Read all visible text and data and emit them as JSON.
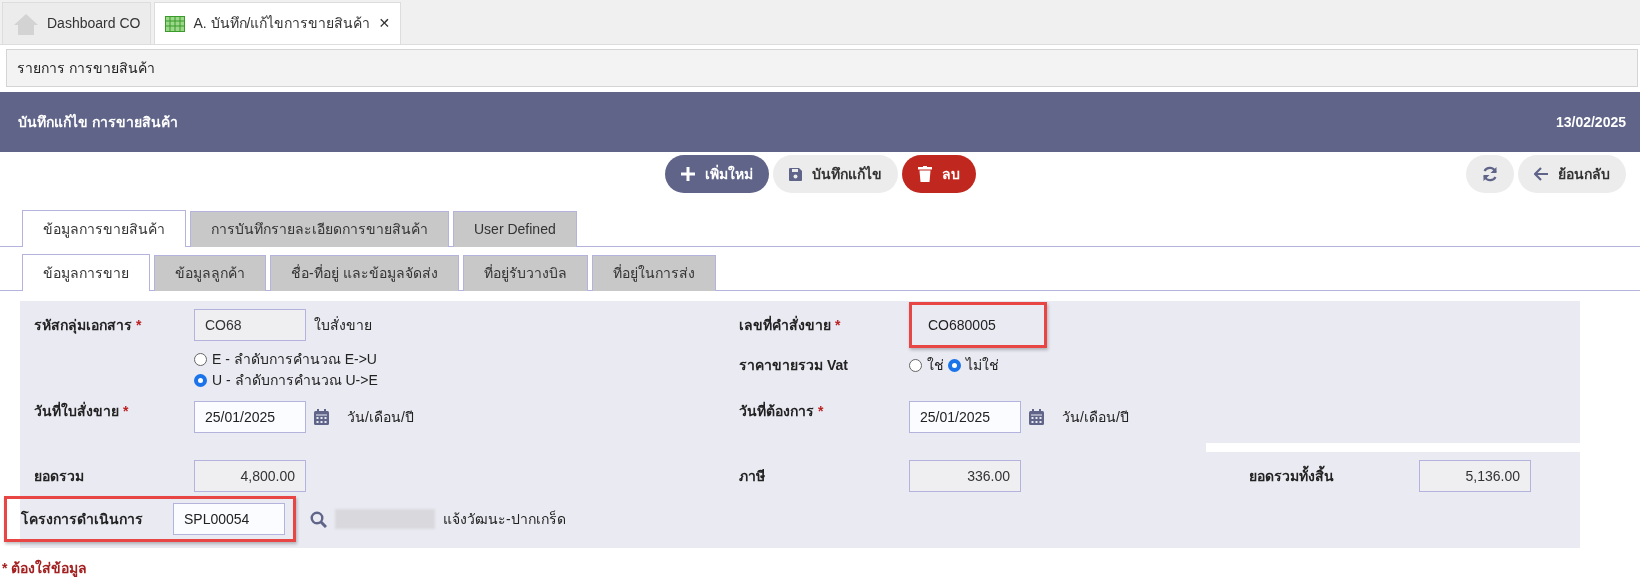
{
  "tabs": [
    {
      "label": "Dashboard CO",
      "selected": false
    },
    {
      "label": "A. บันทึก/แก้ไขการขายสินค้า",
      "selected": true,
      "close": "✕"
    }
  ],
  "breadcrumb": {
    "link": "รายการ การขายสินค้า"
  },
  "header": {
    "title": "บันทึกแก้ไข การขายสินค้า",
    "date": "13/02/2025"
  },
  "toolbar": {
    "buttons": [
      {
        "kind": "primary",
        "label": "เพิ่มใหม่"
      },
      {
        "kind": "light",
        "label": "บันทึกแก้ไข"
      },
      {
        "kind": "danger",
        "label": "ลบ"
      }
    ],
    "right_buttons": [
      {
        "kind": "light"
      },
      {
        "kind": "light",
        "label": "ย้อนกลับ"
      }
    ]
  },
  "main_tabs": [
    {
      "label": "ข้อมูลการขายสินค้า",
      "selected": true
    },
    {
      "label": "การบันทึกรายละเอียดการขายสินค้า",
      "selected": false
    },
    {
      "label": "User Defined",
      "selected": false
    }
  ],
  "sub_tabs": [
    {
      "label": "ข้อมูลการขาย",
      "selected": true
    },
    {
      "label": "ข้อมูลลูกค้า",
      "selected": false
    },
    {
      "label": "ชื่อ-ที่อยู่ และข้อมูลจัดส่ง",
      "selected": false
    },
    {
      "label": "ที่อยู่รับวางบิล",
      "selected": false
    },
    {
      "label": "ที่อยู่ในการส่ง",
      "selected": false
    }
  ],
  "form": {
    "doc_group": {
      "label": "รหัสกลุ่มเอกสาร",
      "required_mark": "*",
      "value": "CO68",
      "readonly": true,
      "suffix": "ใบสั่งขาย"
    },
    "order_no": {
      "label": "เลขที่คำสั่งขาย",
      "required_mark": "*",
      "value": "CO680005",
      "highlighted": true
    },
    "calc_order": [
      {
        "label": "E - ลำดับการคำนวณ E->U",
        "selected": false
      },
      {
        "label": "U - ลำดับการคำนวณ U->E",
        "selected": true
      }
    ],
    "vat": {
      "label": "ราคาขายรวม Vat",
      "options": [
        {
          "label": "ใช่",
          "selected": false
        },
        {
          "label": "ไม่ใช่",
          "selected": true
        }
      ]
    },
    "order_date": {
      "label": "วันที่ใบสั่งขาย",
      "required_mark": "*",
      "value": "25/01/2025",
      "readonly": false,
      "hint": "วัน/เดือน/ปี"
    },
    "due_date": {
      "label": "วันที่ต้องการ",
      "required_mark": "*",
      "value": "25/01/2025",
      "readonly": false,
      "hint": "วัน/เดือน/ปี"
    },
    "subtotal": {
      "label": "ยอดรวม",
      "value": "4,800.00",
      "readonly": true
    },
    "tax": {
      "label": "ภาษี",
      "value": "336.00",
      "readonly": true
    },
    "total": {
      "label": "ยอดรวมทั้งสิ้น",
      "value": "5,136.00",
      "readonly": true
    },
    "project": {
      "label": "โครงการดำเนินการ",
      "value": "SPL00054",
      "readonly": false,
      "highlighted": true,
      "description": "แจ้งวัฒนะ-ปากเกร็ด"
    }
  },
  "required_note": "* ต้องใส่ข้อมูล"
}
